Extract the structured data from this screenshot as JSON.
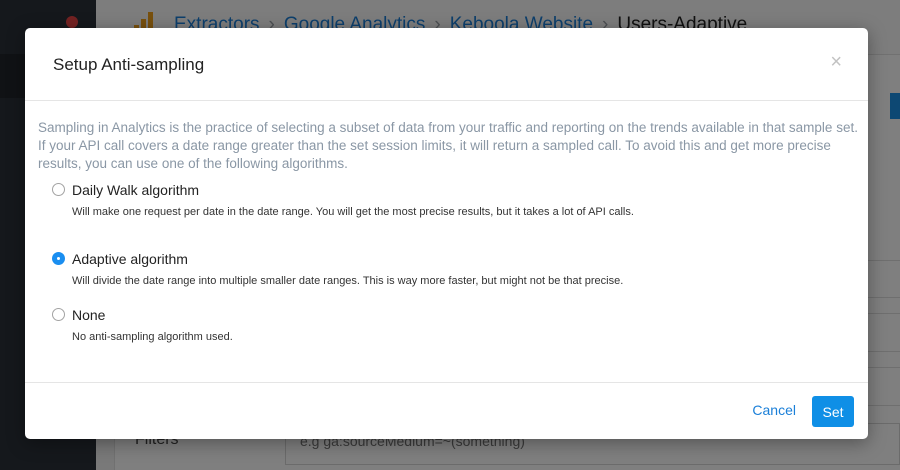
{
  "background": {
    "breadcrumb": [
      "Extractors",
      "Google Analytics",
      "Keboola Website",
      "Users-Adaptive"
    ],
    "filters_label": "Filters",
    "filters_placeholder": "e.g ga:sourceMedium=~(something)"
  },
  "modal": {
    "title": "Setup Anti-sampling",
    "close_label": "×",
    "intro": "Sampling in Analytics is the practice of selecting a subset of data from your traffic and reporting on the trends available in that sample set. If your API call covers a date range greater than the set session limits, it will return a sampled call. To avoid this and get more precise results, you can use one of the following algorithms.",
    "options": [
      {
        "label": "Daily Walk algorithm",
        "description": "Will make one request per date in the date range. You will get the most precise results, but it takes a lot of API calls.",
        "selected": false
      },
      {
        "label": "Adaptive algorithm",
        "description": "Will divide the date range into multiple smaller date ranges. This is way more faster, but might not be that precise.",
        "selected": true
      },
      {
        "label": "None",
        "description": "No anti-sampling algorithm used.",
        "selected": false
      }
    ],
    "cancel_label": "Cancel",
    "set_label": "Set"
  },
  "colors": {
    "accent": "#1a8ef0",
    "link": "#1a7fd8",
    "intro_text": "#8a97a5",
    "sidebar": "#2b3038"
  }
}
